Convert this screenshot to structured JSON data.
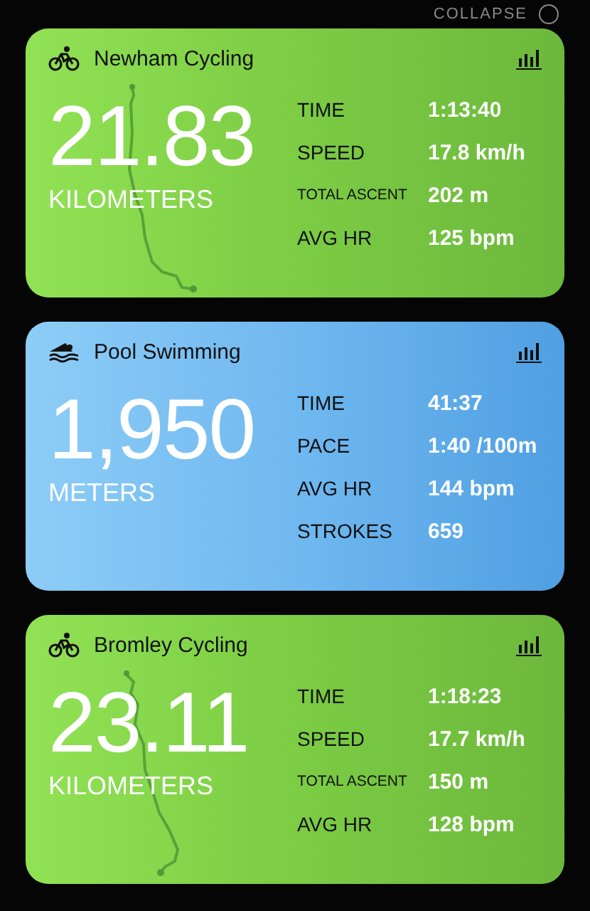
{
  "header": {
    "collapse_label": "COLLAPSE"
  },
  "workouts": [
    {
      "kind": "cycling",
      "title": "Newham Cycling",
      "distance": "21.83",
      "unit": "KILOMETERS",
      "stats": [
        {
          "label": "TIME",
          "value": "1:13:40"
        },
        {
          "label": "SPEED",
          "value": "17.8 km/h"
        },
        {
          "label": "TOTAL ASCENT",
          "value": "202 m"
        },
        {
          "label": "AVG HR",
          "value": "125 bpm"
        }
      ]
    },
    {
      "kind": "swimming",
      "title": "Pool Swimming",
      "distance": "1,950",
      "unit": "METERS",
      "stats": [
        {
          "label": "TIME",
          "value": "41:37"
        },
        {
          "label": "PACE",
          "value": "1:40 /100m"
        },
        {
          "label": "AVG HR",
          "value": "144 bpm"
        },
        {
          "label": "STROKES",
          "value": "659"
        }
      ]
    },
    {
      "kind": "cycling",
      "title": "Bromley Cycling",
      "distance": "23.11",
      "unit": "KILOMETERS",
      "stats": [
        {
          "label": "TIME",
          "value": "1:18:23"
        },
        {
          "label": "SPEED",
          "value": "17.7 km/h"
        },
        {
          "label": "TOTAL ASCENT",
          "value": "150 m"
        },
        {
          "label": "AVG HR",
          "value": "128 bpm"
        }
      ]
    }
  ]
}
